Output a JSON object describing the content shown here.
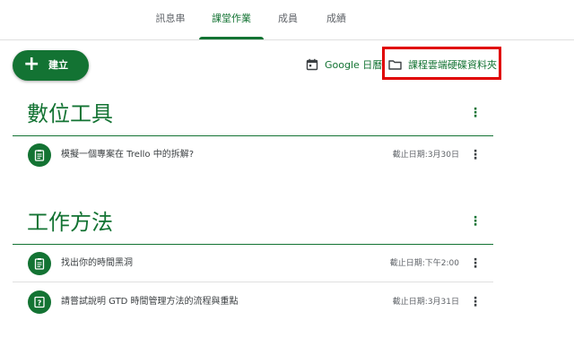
{
  "tabs": [
    {
      "label": "訊息串"
    },
    {
      "label": "課堂作業"
    },
    {
      "label": "成員"
    },
    {
      "label": "成績"
    }
  ],
  "toolbar": {
    "create_label": "建立",
    "calendar_label": "Google 日曆",
    "drive_label": "課程雲端硬碟資料夾"
  },
  "topics": [
    {
      "title": "數位工具",
      "items": [
        {
          "title": "模擬一個專案在 Trello 中的拆解?",
          "due": "截止日期:3月30日",
          "icon": "assignment-icon"
        }
      ]
    },
    {
      "title": "工作方法",
      "items": [
        {
          "title": "找出你的時間黑洞",
          "due": "截止日期:下午2:00",
          "icon": "assignment-icon"
        },
        {
          "title": "請嘗試說明 GTD 時間管理方法的流程與重點",
          "due": "截止日期:3月31日",
          "icon": "question-icon"
        }
      ]
    }
  ],
  "colors": {
    "accent": "#137333",
    "highlight": "#e00000"
  }
}
